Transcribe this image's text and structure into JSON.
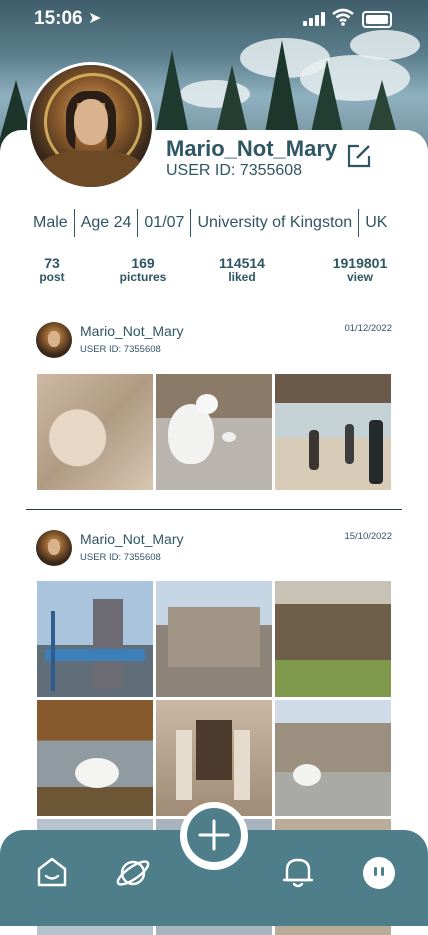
{
  "status_bar": {
    "time": "15:06"
  },
  "profile": {
    "username": "Mario_Not_Mary",
    "user_id": "USER ID: 7355608",
    "info": [
      "Male",
      "Age 24",
      "01/07",
      "University of Kingston",
      "UK"
    ],
    "stats": [
      {
        "value": "73",
        "label": "post"
      },
      {
        "value": "169",
        "label": "pictures"
      },
      {
        "value": "114514",
        "label": "liked"
      },
      {
        "value": "1919801",
        "label": "view"
      }
    ]
  },
  "posts": [
    {
      "author": "Mario_Not_Mary",
      "user_id": "USER ID: 7355608",
      "date": "01/12/2022",
      "photos": [
        "stone-carving",
        "seagull",
        "station-people"
      ]
    },
    {
      "author": "Mario_Not_Mary",
      "user_id": "USER ID: 7355608",
      "date": "15/10/2022",
      "photos": [
        "tower-bridge",
        "tower-of-london",
        "park-trees",
        "swan-lake",
        "museum-statues",
        "castle-seagull"
      ]
    }
  ],
  "nav": {
    "icons": [
      "home-icon",
      "planet-icon",
      "add-icon",
      "bell-icon",
      "profile-icon"
    ]
  },
  "colors": {
    "accent": "#4f7e8b",
    "text": "#2f5663"
  }
}
